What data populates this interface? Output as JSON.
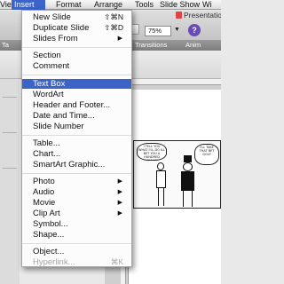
{
  "menubar": {
    "view": "View",
    "insert": "Insert",
    "format": "Format",
    "arrange": "Arrange",
    "tools": "Tools",
    "slide_show": "Slide Show",
    "window": "Wi"
  },
  "toolbar": {
    "doc_title": "Presentation",
    "zoom": "75%",
    "help": "?"
  },
  "ribbon": {
    "tab_left": "Ta",
    "transitions": "Transitions",
    "animations": "Anim"
  },
  "insert_menu": {
    "items": [
      {
        "label": "New Slide",
        "shortcut": "⇧⌘N"
      },
      {
        "label": "Duplicate Slide",
        "shortcut": "⇧⌘D"
      },
      {
        "label": "Slides From",
        "submenu": "▶"
      },
      {
        "label": "Section"
      },
      {
        "label": "Comment"
      },
      {
        "label": "Text Box",
        "selected": true
      },
      {
        "label": "WordArt"
      },
      {
        "label": "Header and Footer..."
      },
      {
        "label": "Date and Time..."
      },
      {
        "label": "Slide Number"
      },
      {
        "label": "Table..."
      },
      {
        "label": "Chart..."
      },
      {
        "label": "SmartArt Graphic..."
      },
      {
        "label": "Photo",
        "submenu": "▶"
      },
      {
        "label": "Audio",
        "submenu": "▶"
      },
      {
        "label": "Movie",
        "submenu": "▶"
      },
      {
        "label": "Clip Art",
        "submenu": "▶"
      },
      {
        "label": "Symbol..."
      },
      {
        "label": "Shape..."
      },
      {
        "label": "Object..."
      },
      {
        "label": "Hyperlink...",
        "shortcut": "⌘K",
        "disabled": true
      }
    ]
  },
  "cartoon": {
    "bubble_left": "I TELL YOU WHAT I'LL DO ILL BET YOU A HUNDRED DOLLARS",
    "bubble_right": "I'LL TAKE THAT BET GOLF"
  },
  "colors": {
    "menu_highlight": "#3b63c8",
    "help_button": "#6a4ab8"
  }
}
